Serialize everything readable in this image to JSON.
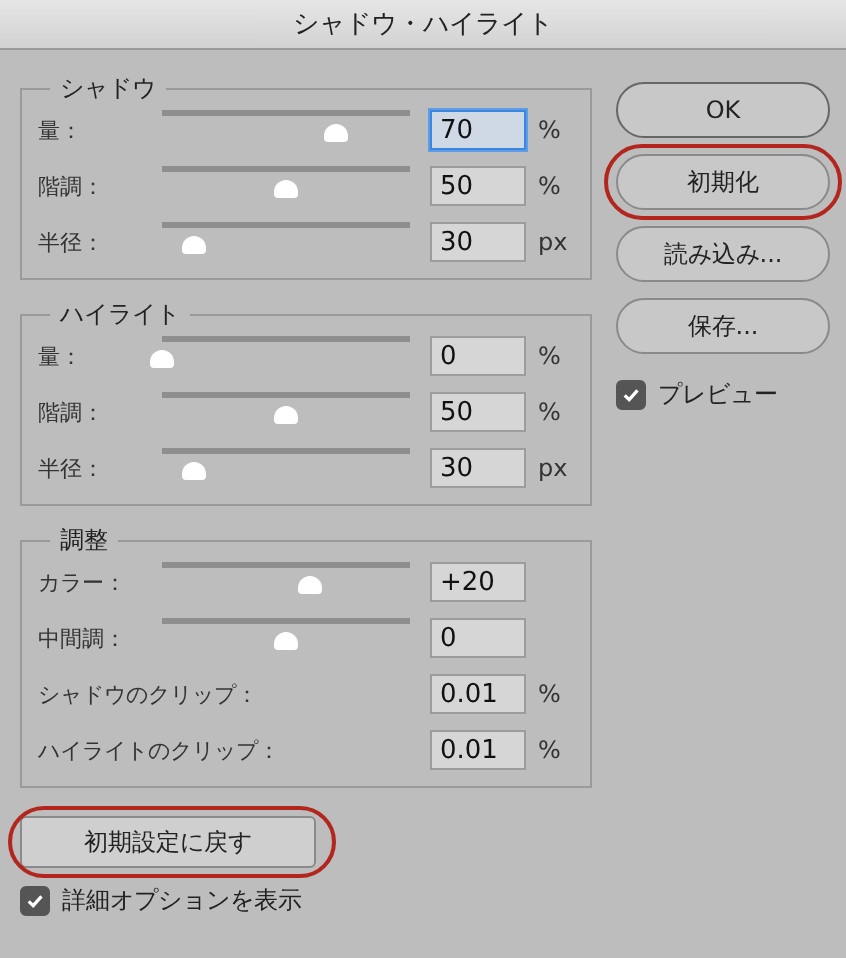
{
  "window": {
    "title": "シャドウ・ハイライト"
  },
  "groups": [
    {
      "title": "シャドウ",
      "rows": [
        {
          "kind": "slider",
          "label": "量：",
          "level": 0.7,
          "value": "70",
          "unit": "%",
          "focused": true
        },
        {
          "kind": "slider",
          "label": "階調：",
          "level": 0.5,
          "value": "50",
          "unit": "%",
          "focused": false
        },
        {
          "kind": "slider",
          "label": "半径：",
          "level": 0.13,
          "value": "30",
          "unit": "px",
          "focused": false
        }
      ]
    },
    {
      "title": "ハイライト",
      "rows": [
        {
          "kind": "slider",
          "label": "量：",
          "level": 0,
          "value": "0",
          "unit": "%",
          "focused": false
        },
        {
          "kind": "slider",
          "label": "階調：",
          "level": 0.5,
          "value": "50",
          "unit": "%",
          "focused": false
        },
        {
          "kind": "slider",
          "label": "半径：",
          "level": 0.13,
          "value": "30",
          "unit": "px",
          "focused": false
        }
      ]
    },
    {
      "title": "調整",
      "rows": [
        {
          "kind": "slider",
          "label": "カラー：",
          "level": 0.6,
          "value": "+20",
          "focused": false
        },
        {
          "kind": "slider",
          "label": "中間調：",
          "level": 0.5,
          "value": "0",
          "focused": false
        },
        {
          "kind": "field",
          "label": "シャドウのクリップ：",
          "value": "0.01",
          "unit": "%",
          "focused": false
        },
        {
          "kind": "field",
          "label": "ハイライトのクリップ：",
          "value": "0.01",
          "unit": "%",
          "focused": false
        }
      ]
    }
  ],
  "reset_button": {
    "label": "初期設定に戻す",
    "circled": true
  },
  "more_options": {
    "label": "詳細オプションを表示",
    "checked": true
  },
  "buttons": [
    {
      "label": "OK",
      "default": true,
      "circled": false
    },
    {
      "label": "初期化",
      "default": false,
      "circled": true
    },
    {
      "label": "読み込み...",
      "default": false,
      "circled": false
    },
    {
      "label": "保存...",
      "default": false,
      "circled": false
    }
  ],
  "preview": {
    "label": "プレビュー",
    "checked": true
  }
}
